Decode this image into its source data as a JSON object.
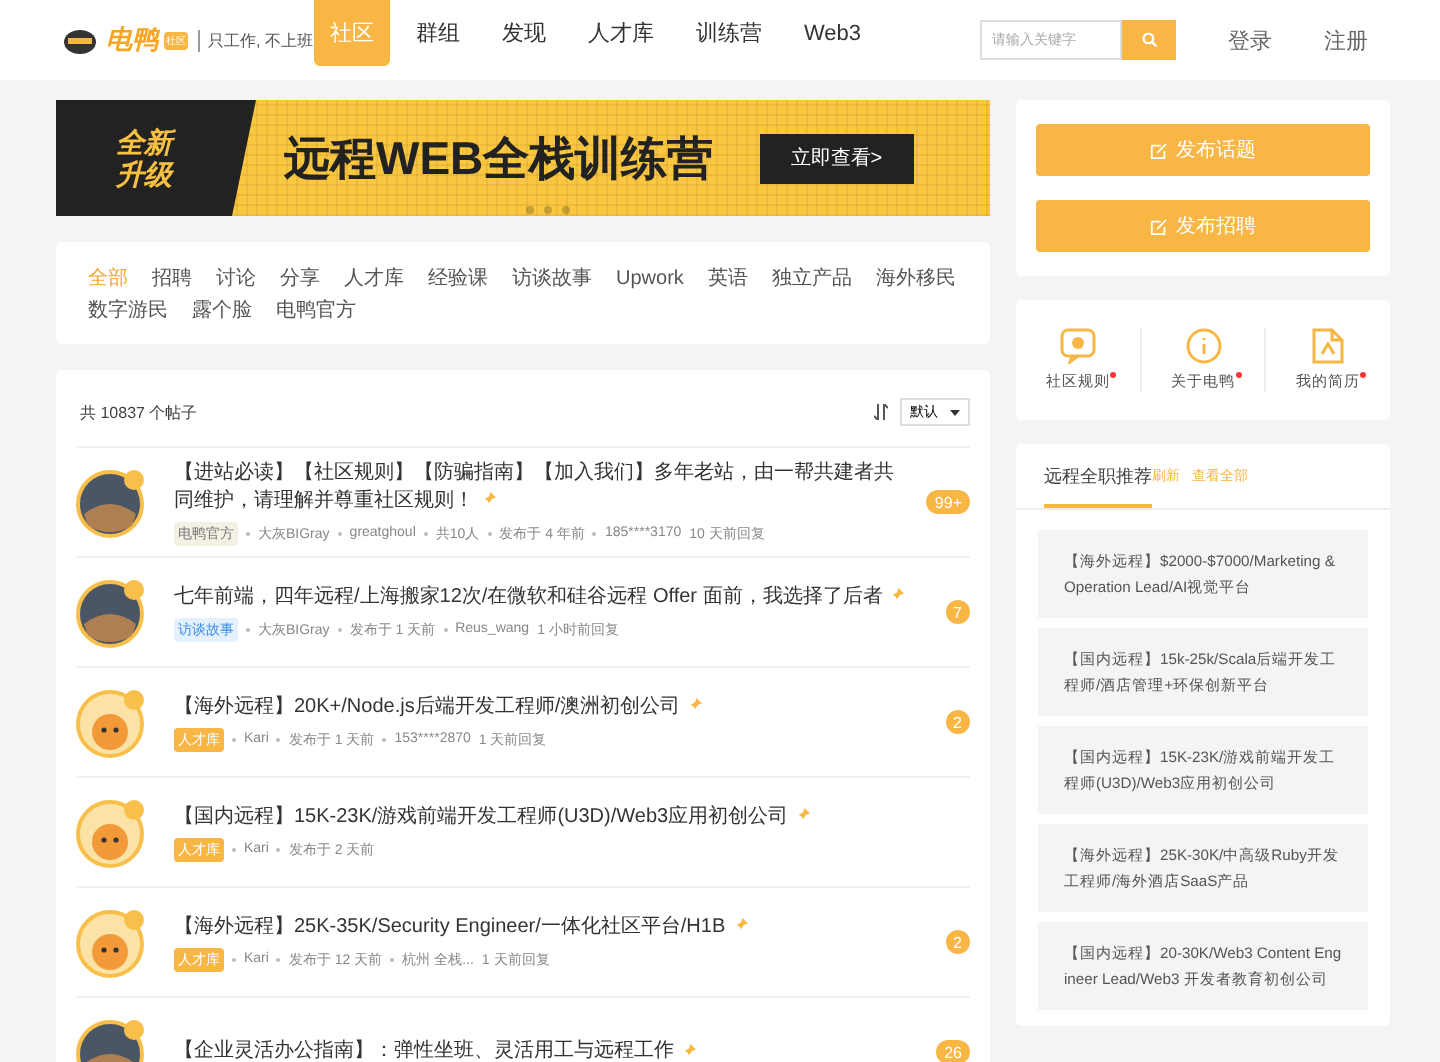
{
  "header": {
    "logo_text": "电鸭",
    "logo_badge": "社区",
    "slogan": "只工作, 不上班",
    "nav": [
      {
        "label": "社区",
        "selected": true
      },
      {
        "label": "群组",
        "selected": false
      },
      {
        "label": "发现",
        "selected": false
      },
      {
        "label": "人才库",
        "selected": false
      },
      {
        "label": "训练营",
        "selected": false
      },
      {
        "label": "Web3",
        "selected": false
      }
    ],
    "search": {
      "placeholder": "请输入关键字"
    },
    "login": "登录",
    "register": "注册"
  },
  "banner": {
    "badge_lines": [
      "全新",
      "升级"
    ],
    "title": "远程WEB全栈训练营",
    "cta": "立即查看>"
  },
  "categories": [
    {
      "label": "全部",
      "selected": true
    },
    {
      "label": "招聘",
      "selected": false
    },
    {
      "label": "讨论",
      "selected": false
    },
    {
      "label": "分享",
      "selected": false
    },
    {
      "label": "人才库",
      "selected": false
    },
    {
      "label": "经验课",
      "selected": false
    },
    {
      "label": "访谈故事",
      "selected": false
    },
    {
      "label": "Upwork",
      "selected": false
    },
    {
      "label": "英语",
      "selected": false
    },
    {
      "label": "独立产品",
      "selected": false
    },
    {
      "label": "海外移民",
      "selected": false
    },
    {
      "label": "数字游民",
      "selected": false
    },
    {
      "label": "露个脸",
      "selected": false
    },
    {
      "label": "电鸭官方",
      "selected": false
    }
  ],
  "post_list": {
    "count": "共 10837 个帖子",
    "sort": "默认",
    "posts": [
      {
        "avatar": {
          "kind": "photo"
        },
        "title": "【进站必读】【社区规则】【防骗指南】【加入我们】多年老站，由一帮共建者共同维护，请理解并尊重社区规则！",
        "tag": {
          "kind": "official",
          "label": "电鸭官方"
        },
        "meta": [
          "大灰BIGray",
          "greatghoul",
          "共10人",
          "发布于 4 年前"
        ],
        "last": "185****3170",
        "reply": "10 天前回复",
        "count": "99+"
      },
      {
        "avatar": {
          "kind": "photo"
        },
        "title": "七年前端，四年远程/上海搬家12次/在微软和硅谷远程 Offer 面前，我选择了后者",
        "tag": {
          "kind": "story",
          "label": "访谈故事"
        },
        "meta": [
          "大灰BIGray",
          "发布于 1 天前"
        ],
        "last": "Reus_wang",
        "reply": "1 小时前回复",
        "count": "7"
      },
      {
        "avatar": {
          "kind": "cartoon"
        },
        "title": "【海外远程】20K+/Node.js后端开发工程师/澳洲初创公司",
        "tag": {
          "kind": "talent",
          "label": "人才库"
        },
        "meta": [
          "Kari",
          "发布于 1 天前"
        ],
        "last": "153****2870",
        "reply": "1 天前回复",
        "count": "2"
      },
      {
        "avatar": {
          "kind": "cartoon"
        },
        "title": "【国内远程】15K-23K/游戏前端开发工程师(U3D)/Web3应用初创公司",
        "tag": {
          "kind": "talent",
          "label": "人才库"
        },
        "meta": [
          "Kari",
          "发布于 2 天前"
        ]
      },
      {
        "avatar": {
          "kind": "cartoon"
        },
        "title": "【海外远程】25K-35K/Security Engineer/一体化社区平台/H1B",
        "tag": {
          "kind": "talent",
          "label": "人才库"
        },
        "meta": [
          "Kari",
          "发布于 12 天前"
        ],
        "last": "杭州 全栈...",
        "reply": "1 天前回复",
        "count": "2"
      },
      {
        "avatar": {
          "kind": "photo"
        },
        "title": "【企业灵活办公指南】：弹性坐班、灵活用工与远程工作",
        "count": "26"
      }
    ]
  },
  "actions": [
    "发布话题",
    "发布招聘"
  ],
  "shortcuts": [
    {
      "kind": "rules",
      "label": "社区规则",
      "dot": true
    },
    {
      "kind": "about",
      "label": "关于电鸭",
      "dot": true
    },
    {
      "kind": "resume",
      "label": "我的简历",
      "dot": true
    }
  ],
  "recommend": {
    "tabs": [
      {
        "label": "远程全职推荐",
        "selected": true
      }
    ],
    "refresh": "刷新",
    "all": "查看全部",
    "items": [
      "【海外远程】$2000-$7000/Marketing & Operation Lead/AI视觉平台",
      "【国内远程】15k-25k/Scala后端开发工程师/酒店管理+环保创新平台",
      "【国内远程】15K-23K/游戏前端开发工程师(U3D)/Web3应用初创公司",
      "【海外远程】25K-30K/中高级Ruby开发工程师/海外酒店SaaS产品",
      "【国内远程】20-30K/Web3 Content Engineer Lead/Web3 开发者教育初创公司"
    ]
  }
}
